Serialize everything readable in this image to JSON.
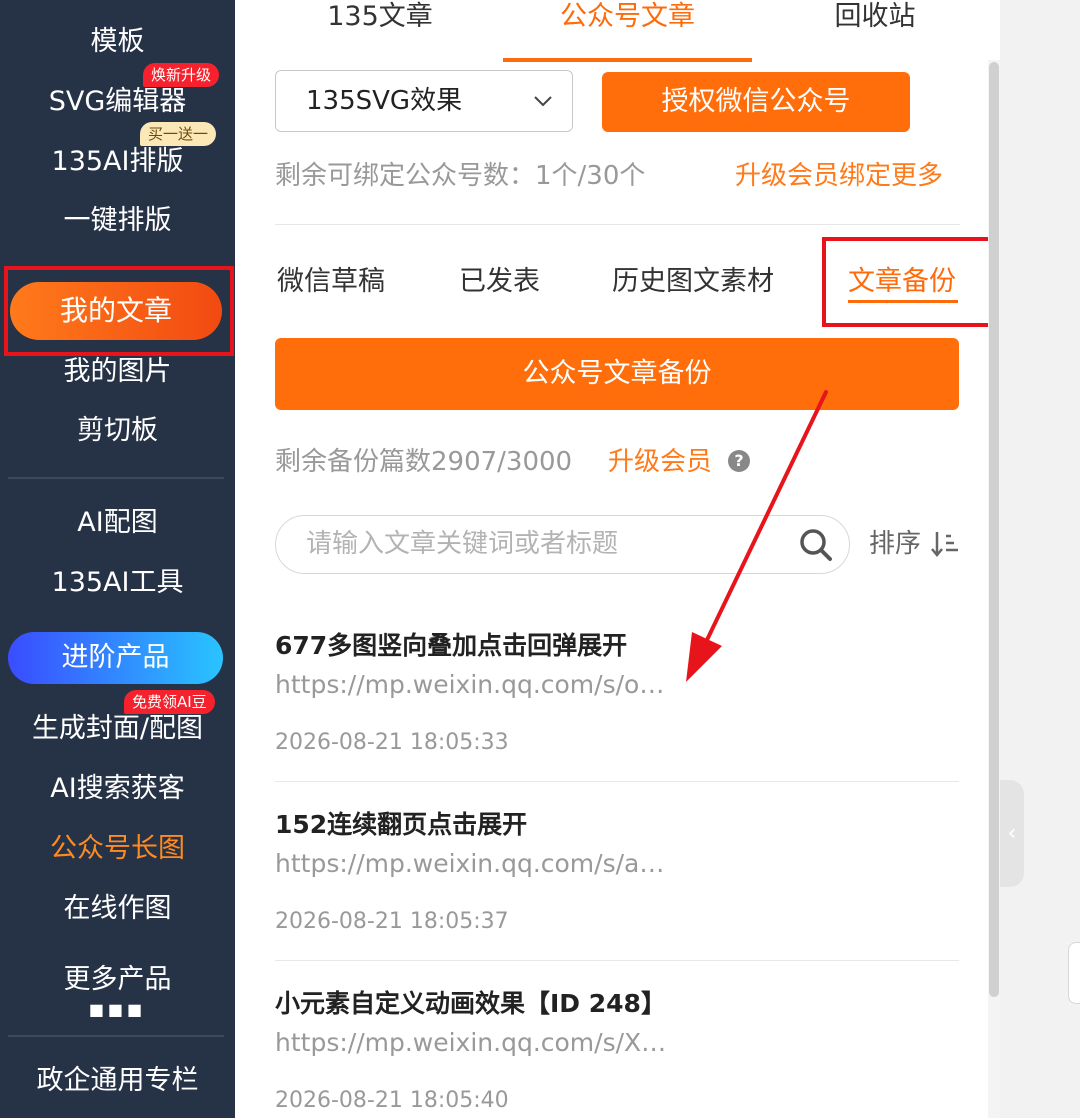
{
  "sidebar": {
    "items": [
      {
        "label": "模板"
      },
      {
        "label": "SVG编辑器",
        "badge": "焕新升级"
      },
      {
        "label": "135AI排版",
        "badge": "买一送一"
      },
      {
        "label": "一键排版"
      },
      {
        "label": "我的文章",
        "active": true
      },
      {
        "label": "我的图片"
      },
      {
        "label": "剪切板"
      },
      {
        "label": "AI配图"
      },
      {
        "label": "135AI工具"
      },
      {
        "label": "进阶产品"
      },
      {
        "label": "生成封面/配图",
        "badge": "免费领AI豆"
      },
      {
        "label": "AI搜索获客"
      },
      {
        "label": "公众号长图",
        "highlight": true
      },
      {
        "label": "在线作图"
      },
      {
        "label": "更多产品"
      },
      {
        "label": "政企通用专栏"
      }
    ]
  },
  "top_tabs": [
    {
      "label": "135文章"
    },
    {
      "label": "公众号文章",
      "active": true
    },
    {
      "label": "回收站"
    }
  ],
  "account_select": {
    "value": "135SVG效果"
  },
  "authorize_button": "授权微信公众号",
  "bind_remaining": "剩余可绑定公众号数：1个/30个",
  "upgrade_bind_link": "升级会员绑定更多",
  "sub_tabs": [
    {
      "label": "微信草稿"
    },
    {
      "label": "已发表"
    },
    {
      "label": "历史图文素材"
    },
    {
      "label": "文章备份",
      "active": true
    }
  ],
  "backup_button": "公众号文章备份",
  "backup_remaining": "剩余备份篇数2907/3000",
  "upgrade_member_link": "升级会员",
  "search": {
    "placeholder": "请输入文章关键词或者标题"
  },
  "sort_label": "排序",
  "articles": [
    {
      "title": "677多图竖向叠加点击回弹展开",
      "url": "https://mp.weixin.qq.com/s/o…",
      "date": "2026-08-21 18:05:33"
    },
    {
      "title": "152连续翻页点击展开",
      "url": "https://mp.weixin.qq.com/s/a…",
      "date": "2026-08-21 18:05:37"
    },
    {
      "title": "小元素自定义动画效果【ID 248】",
      "url": "https://mp.weixin.qq.com/s/X…",
      "date": "2026-08-21 18:05:40"
    }
  ],
  "colors": {
    "sidebar_bg": "#263246",
    "accent_orange": "#ff6e0a",
    "annotation_red": "#e8141b",
    "advanced_gradient_start": "#3a4cff",
    "advanced_gradient_end": "#29c4ff"
  }
}
